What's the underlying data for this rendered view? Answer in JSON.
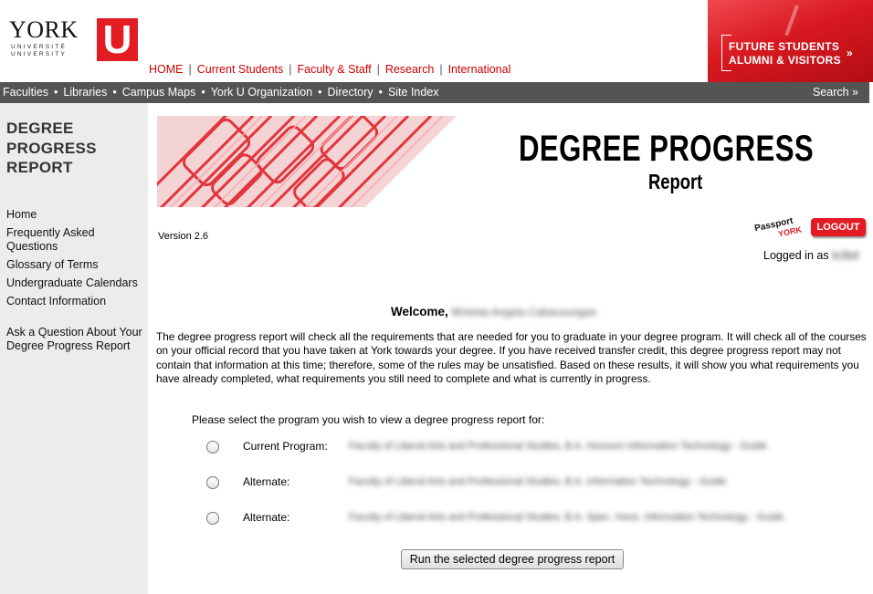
{
  "header": {
    "logo": {
      "york": "YORK",
      "university_line1": "UNIVERSITÉ",
      "university_line2": "UNIVERSITY",
      "u": "U"
    },
    "topnav": [
      "HOME",
      "Current Students",
      "Faculty & Staff",
      "Research",
      "International"
    ],
    "promo": {
      "line1": "FUTURE STUDENTS",
      "line2": "ALUMNI & VISITORS",
      "arrow": "»"
    }
  },
  "greybar": {
    "links": [
      "Faculties",
      "Libraries",
      "Campus Maps",
      "York U Organization",
      "Directory",
      "Site Index"
    ],
    "search": "Search »"
  },
  "sidebar": {
    "title_lines": [
      "DEGREE",
      "PROGRESS",
      "REPORT"
    ],
    "menu": [
      "Home",
      "Frequently Asked Questions",
      "Glossary of Terms",
      "Undergraduate Calendars",
      "Contact Information"
    ],
    "ask": "Ask a Question About Your Degree Progress Report"
  },
  "main": {
    "title": "DEGREE PROGRESS",
    "subtitle": "Report",
    "version": "Version 2.6",
    "passport": {
      "line1": "Passport",
      "line2": "YORK"
    },
    "logout": "LOGOUT",
    "logged_in": "Logged in as",
    "logged_user": "kclbd",
    "welcome": "Welcome,",
    "welcome_name": "Mckinia Angela Cabaceungan",
    "intro": "The degree progress report will check all the requirements that are needed for you to graduate in your degree program. It will check all of the courses on your official record that you have taken at York towards your degree. If you have received transfer credit, this degree progress report may not contain that information at this time; therefore, some of the rules may be unsatisfied. Based on these results, it will show you what requirements you have already completed, what requirements you still need to complete and what is currently in progress.",
    "prompt": "Please select the program you wish to view a degree progress report for:",
    "programs": [
      {
        "label": "Current Program:",
        "value": "Faculty of Liberal Arts and Professional Studies, B.A. Honours Information Technology - Guide"
      },
      {
        "label": "Alternate:",
        "value": "Faculty of Liberal Arts and Professional Studies, B.A. Information Technology - Guide"
      },
      {
        "label": "Alternate:",
        "value": "Faculty of Liberal Arts and Professional Studies, B.A. Spec. Hons. Information Technology - Guide"
      }
    ],
    "run_button": "Run the selected degree progress report"
  },
  "colors": {
    "york_red": "#e31b23",
    "grey_bar": "#545454",
    "sidebar_bg": "#ececec",
    "nav_red": "#cc0000"
  }
}
